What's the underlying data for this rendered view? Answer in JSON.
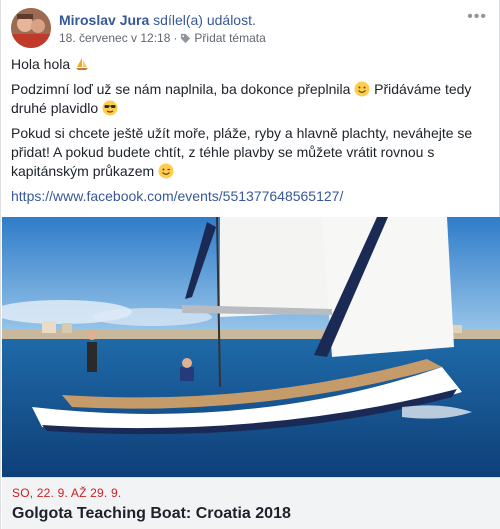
{
  "post": {
    "author": "Miroslav Jura",
    "action": "sdílel(a) událost.",
    "timestamp": "18. červenec v 12:18",
    "tag_label": "Přidat témata",
    "menu_icon": "more-dots-icon",
    "paragraphs": {
      "p1": "Hola hola",
      "p2a": "Podzimní loď už se nám naplnila, ba dokonce přeplnila",
      "p2b": "Přidáváme tedy druhé plavidlo",
      "p3": "Pokud si chcete ještě užít moře, pláže, ryby a hlavně plachty, neváhejte se přidat! A pokud budete chtít, z téhle plavby se můžete vrátit rovnou s kapitánským průkazem"
    },
    "link": "https://www.facebook.com/events/551377648565127/"
  },
  "event": {
    "date": "SO, 22. 9. AŽ 29. 9.",
    "title": "Golgota Teaching Boat: Croatia 2018"
  },
  "colors": {
    "link": "#365899",
    "date_accent": "#cc2020",
    "footer_bg": "#f2f3f5"
  }
}
